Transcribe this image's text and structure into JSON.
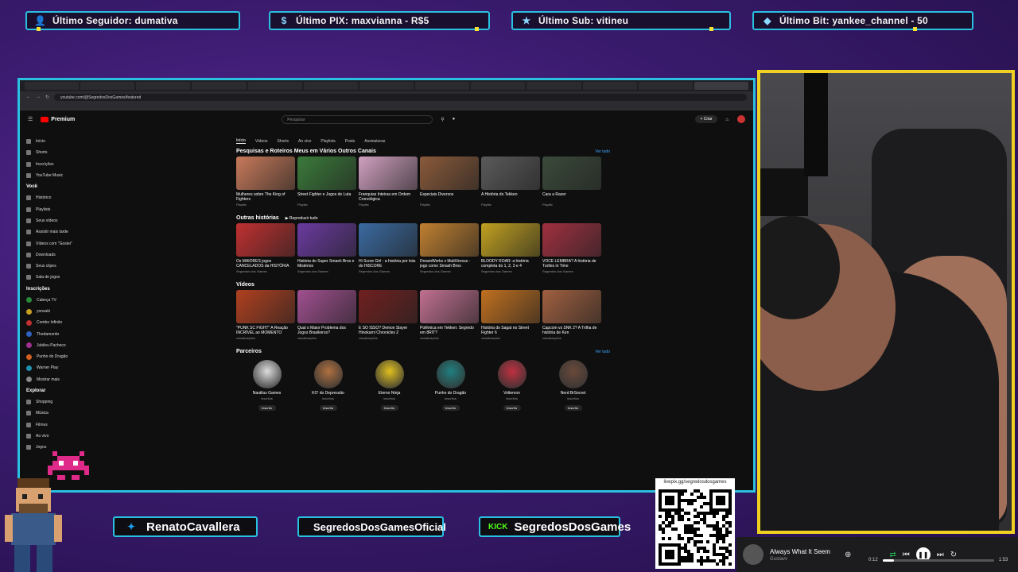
{
  "alerts": [
    {
      "icon": "user-icon",
      "text": "Último Seguidor: dumativa"
    },
    {
      "icon": "pix-icon",
      "text": "Último PIX: maxvianna - R$5"
    },
    {
      "icon": "star-icon",
      "text": "Último Sub: vitineu"
    },
    {
      "icon": "diamond-icon",
      "text": "Último Bit: yankee_channel - 50"
    }
  ],
  "browser": {
    "url": "youtube.com/@SegredosDosGames/featured",
    "search_placeholder": "Pesquisar",
    "create_label": "+ Criar",
    "logo_label": "Premium"
  },
  "sidebar": {
    "main": [
      "Início",
      "Shorts",
      "Inscrições",
      "YouTube Music"
    ],
    "you_header": "Você",
    "you": [
      "Histórico",
      "Playlists",
      "Seus vídeos",
      "Assistir mais tarde",
      "Vídeos com \"Gostei\"",
      "Downloads",
      "Seus clipes",
      "Sala de jogos"
    ],
    "subs_header": "Inscrições",
    "subs": [
      "Cabeça TV",
      "yonsaki",
      "Combo Infinito",
      "Thedamonbr",
      "Jubileu Pacheco",
      "Punho do Dragão",
      "Warner Play",
      "Mostrar mais"
    ],
    "explore_header": "Explorar",
    "explore": [
      "Shopping",
      "Música",
      "Filmes",
      "Ao vivo",
      "Jogos"
    ]
  },
  "channel_tabs": [
    "Início",
    "Vídeos",
    "Shorts",
    "Ao vivo",
    "Playlists",
    "Posts",
    "Assinaturas"
  ],
  "rows": [
    {
      "title": "Pesquisas e Roteiros Meus em Vários Outros Canais",
      "link": "Ver tudo",
      "cards": [
        {
          "title": "Mulheres sobre The King of Fighters",
          "meta": "Playlist"
        },
        {
          "title": "Street Fighter e Jogos de Luta",
          "meta": "Playlist"
        },
        {
          "title": "Franquias Inteiras em Ordem Cronológica",
          "meta": "Playlist"
        },
        {
          "title": "Especiais Diversos",
          "meta": "Playlist"
        },
        {
          "title": "A História do Tekken",
          "meta": "Playlist"
        },
        {
          "title": "Cara a Razer",
          "meta": "Playlist"
        }
      ]
    },
    {
      "title": "Outras histórias",
      "link": "Reproduzir tudo",
      "cards": [
        {
          "title": "Os MAIORES jogos CANCELADOS da HISTÓRIA",
          "meta": "Segredos dos Games"
        },
        {
          "title": "História do Super Smash Bros e Mistérios",
          "meta": "Segredos dos Games"
        },
        {
          "title": "Hi Score Girl - a história por trás do HiSCORE",
          "meta": "Segredos dos Games"
        },
        {
          "title": "DreamWorks x MultiVersus - jogo como Smash Bros",
          "meta": "Segredos dos Games"
        },
        {
          "title": "BLOODY ROAR: a história completa do 1, 2, 3 e 4",
          "meta": "Segredos dos Games"
        },
        {
          "title": "VOCÊ LEMBRA? A história de Turtles in Time",
          "meta": "Segredos dos Games"
        }
      ]
    },
    {
      "title": "Vídeos",
      "link": "",
      "cards": [
        {
          "title": "\"PUNK SC FIGHT\" A Reação INCRÍVEL ao MOMENTO",
          "meta": "visualizações"
        },
        {
          "title": "Qual o Maior Problema dos Jogos Brasileiros?",
          "meta": "visualizações"
        },
        {
          "title": "É SÓ ISSO? Demon Slayer Hinokami Chronicles 2",
          "meta": "visualizações"
        },
        {
          "title": "Polêmica em Tekken: Segredo em 8RIT?",
          "meta": "visualizações"
        },
        {
          "title": "História do Sagat no Street Fighter 6",
          "meta": "visualizações"
        },
        {
          "title": "Capcom vs SNK 2? A Trilha de história de Ken",
          "meta": "visualizações"
        }
      ]
    }
  ],
  "partners_title": "Parceiros",
  "partners_link": "Ver tudo",
  "partners": [
    {
      "name": "Nautilus Games",
      "subs": "inscritos"
    },
    {
      "name": "KO' do Depressão",
      "subs": "inscritos"
    },
    {
      "name": "Eterno Ninja",
      "subs": "inscritos"
    },
    {
      "name": "Punho do Dragão",
      "subs": "inscritos"
    },
    {
      "name": "Voltemon",
      "subs": "inscritos"
    },
    {
      "name": "Nerd BrSecret",
      "subs": "inscritos"
    }
  ],
  "partner_button": "Inscrito",
  "social": {
    "twitter": "RenatoCavallera",
    "instagram": "SegredosDosGamesOficial",
    "kick_badge": "KICK",
    "kick": "SegredosDosGames"
  },
  "qr": {
    "label": "livepix.gg/segredosdosgames"
  },
  "player": {
    "title": "Always What It Seem",
    "artist": "Gustavv",
    "elapsed": "0:12",
    "duration": "1:53",
    "progress": 0.1
  },
  "colors": {
    "frame": "#2ac0e0",
    "cam_border": "#f0d020",
    "bg": "#3a1b6e"
  }
}
